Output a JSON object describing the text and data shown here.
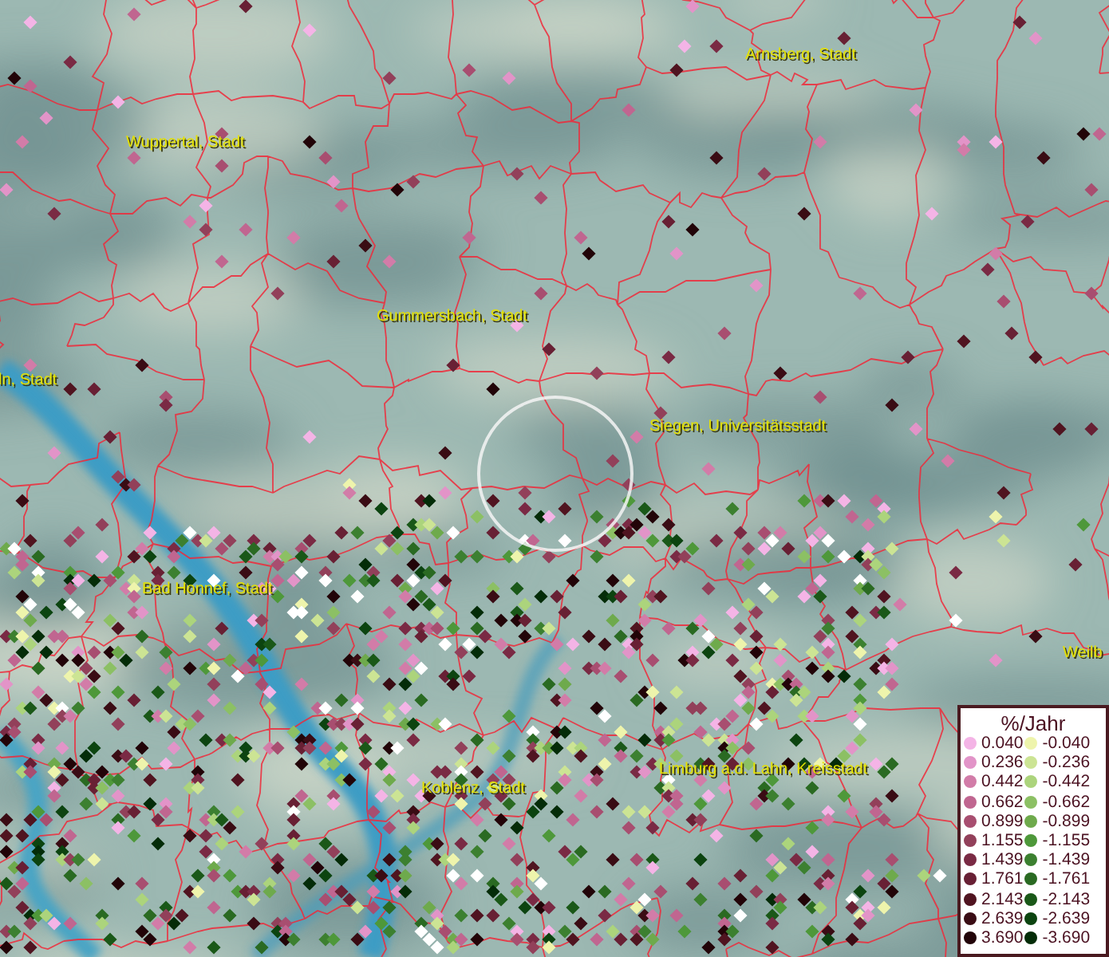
{
  "map": {
    "place_labels": [
      {
        "text": "Arnsberg, Stadt"
      },
      {
        "text": "Wuppertal, Stadt"
      },
      {
        "text": "Gummersbach, Stadt"
      },
      {
        "text": "ln, Stadt"
      },
      {
        "text": "Siegen, Universitätsstadt"
      },
      {
        "text": "Bad Honnef, Stadt"
      },
      {
        "text": "Weilb"
      },
      {
        "text": "Limburg a.d. Lahn, Kreisstadt"
      },
      {
        "text": "Koblenz, Stadt"
      }
    ]
  },
  "legend": {
    "title": "%/Jahr",
    "columns": [
      {
        "items": [
          {
            "label": "0.040",
            "color": "#f4b4e6"
          },
          {
            "label": "0.236",
            "color": "#e294c8"
          },
          {
            "label": "0.442",
            "color": "#d27ca8"
          },
          {
            "label": "0.662",
            "color": "#c06690"
          },
          {
            "label": "0.899",
            "color": "#a84e70"
          },
          {
            "label": "1.155",
            "color": "#92405a"
          },
          {
            "label": "1.439",
            "color": "#7a2a44"
          },
          {
            "label": "1.761",
            "color": "#682034"
          },
          {
            "label": "2.143",
            "color": "#501420"
          },
          {
            "label": "2.639",
            "color": "#3a0c14"
          },
          {
            "label": "3.690",
            "color": "#220408"
          }
        ]
      },
      {
        "items": [
          {
            "label": "-0.040",
            "color": "#eef4ac"
          },
          {
            "label": "-0.236",
            "color": "#cce494"
          },
          {
            "label": "-0.442",
            "color": "#acd47c"
          },
          {
            "label": "-0.662",
            "color": "#8cc064"
          },
          {
            "label": "-0.899",
            "color": "#6eaa4c"
          },
          {
            "label": "-1.155",
            "color": "#4e983a"
          },
          {
            "label": "-1.439",
            "color": "#3c8030"
          },
          {
            "label": "-1.761",
            "color": "#2a6a22"
          },
          {
            "label": "-2.143",
            "color": "#1a5818"
          },
          {
            "label": "-2.639",
            "color": "#0c4410"
          },
          {
            "label": "-3.690",
            "color": "#042c08"
          }
        ]
      }
    ]
  }
}
